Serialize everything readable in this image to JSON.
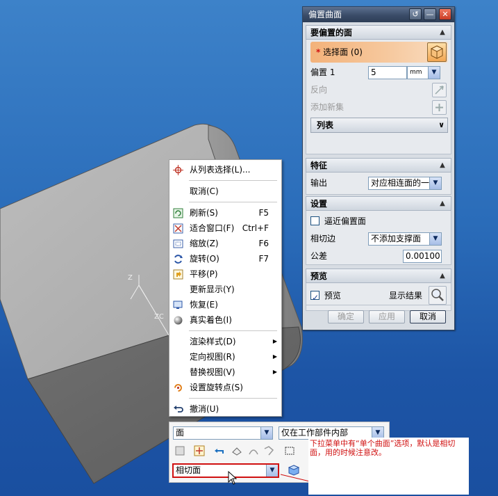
{
  "viewport": {
    "axis_label_z": "Z",
    "axis_label_zc": "ZC"
  },
  "context_menu": {
    "items": [
      {
        "label": "从列表选择(L)...",
        "shortcut": "",
        "submenu": false,
        "icon": "crosshair-icon"
      },
      {
        "label": "取消(C)",
        "shortcut": "",
        "submenu": false,
        "icon": ""
      },
      {
        "label": "刷新(S)",
        "shortcut": "F5",
        "submenu": false,
        "icon": "refresh-icon"
      },
      {
        "label": "适合窗口(F)",
        "shortcut": "Ctrl+F",
        "submenu": false,
        "icon": "fit-window-icon"
      },
      {
        "label": "缩放(Z)",
        "shortcut": "F6",
        "submenu": false,
        "icon": "zoom-icon"
      },
      {
        "label": "旋转(O)",
        "shortcut": "F7",
        "submenu": false,
        "icon": "rotate-icon"
      },
      {
        "label": "平移(P)",
        "shortcut": "",
        "submenu": false,
        "icon": "pan-icon"
      },
      {
        "label": "更新显示(Y)",
        "shortcut": "",
        "submenu": false,
        "icon": ""
      },
      {
        "label": "恢复(E)",
        "shortcut": "",
        "submenu": false,
        "icon": "restore-icon"
      },
      {
        "label": "真实着色(I)",
        "shortcut": "",
        "submenu": false,
        "icon": "true-shading-icon"
      },
      {
        "label": "渲染样式(D)",
        "shortcut": "",
        "submenu": true,
        "icon": ""
      },
      {
        "label": "定向视图(R)",
        "shortcut": "",
        "submenu": true,
        "icon": ""
      },
      {
        "label": "替换视图(V)",
        "shortcut": "",
        "submenu": true,
        "icon": ""
      },
      {
        "label": "设置旋转点(S)",
        "shortcut": "",
        "submenu": false,
        "icon": "rotation-point-icon"
      },
      {
        "label": "撤消(U)",
        "shortcut": "",
        "submenu": false,
        "icon": "undo-icon"
      }
    ]
  },
  "dialog": {
    "title": "偏置曲面",
    "section_faces": {
      "header": "要偏置的面",
      "select_face_label": "选择面 (0)",
      "offset_label": "偏置 1",
      "offset_value": "5",
      "offset_unit": "mm",
      "reverse_label": "反向",
      "add_new_set_label": "添加新集",
      "list_label": "列表"
    },
    "section_feature": {
      "header": "特征",
      "output_label": "输出",
      "output_value": "对应相连面的一"
    },
    "section_settings": {
      "header": "设置",
      "approx_offset_label": "逼近偏置面",
      "tangent_edge_label": "相切边",
      "tangent_edge_value": "不添加支撑面",
      "tolerance_label": "公差",
      "tolerance_value": "0.00100"
    },
    "section_preview": {
      "header": "预览",
      "preview_label": "预览",
      "show_result_label": "显示结果"
    },
    "buttons": {
      "ok": "确定",
      "apply": "应用",
      "cancel": "取消"
    }
  },
  "selection_toolbar": {
    "type_filter": "面",
    "scope_filter": "仅在工作部件内部",
    "face_rule": "相切面"
  },
  "annotation": {
    "text": "下拉菜单中有“单个曲面”选项，默认是相切面，用的时候注意改。"
  },
  "colors": {
    "background_top": "#3d82c9",
    "background_bottom": "#1a4fa0",
    "annotation_text": "#d01010",
    "select_highlight": "#f3b27a"
  }
}
